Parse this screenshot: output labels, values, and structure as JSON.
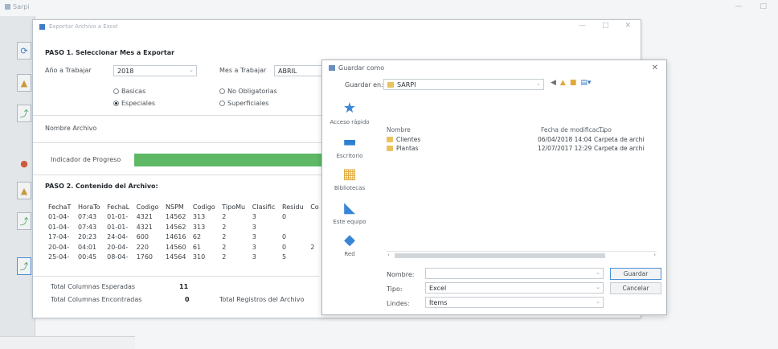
{
  "outer": {
    "title": "Sarpi"
  },
  "main": {
    "title": "Exportar Archivo a Excel",
    "step1": "PASO 1. Seleccionar Mes a Exportar",
    "anio_label": "Año a Trabajar",
    "anio_value": "2018",
    "mes_label": "Mes a Trabajar",
    "mes_value": "ABRIL",
    "radios": [
      {
        "label": "Basicas",
        "checked": false
      },
      {
        "label": "Especiales",
        "checked": true
      },
      {
        "label": "No Obligatorias",
        "checked": false
      },
      {
        "label": "Superficiales",
        "checked": false
      }
    ],
    "nombre_label": "Nombre Archivo",
    "progress_label": "Indicador de Progreso",
    "progress_fraction": 1.0,
    "step2": "PASO 2. Contenido del Archivo:",
    "table": {
      "headers": [
        "FechaT",
        "HoraTo",
        "FechaL",
        "Codigo",
        "NSPM",
        "Codigo",
        "TipoMu",
        "Clasific",
        "Residu",
        "Co"
      ],
      "rows": [
        [
          "01-04-",
          "07:43",
          "01-01-",
          "4321",
          "14562",
          "313",
          "2",
          "3",
          "0",
          ""
        ],
        [
          "01-04-",
          "07:43",
          "01-01-",
          "4321",
          "14562",
          "313",
          "2",
          "3",
          "",
          ""
        ],
        [
          "17-04-",
          "20:23",
          "24-04-",
          "600",
          "14616",
          "62",
          "2",
          "3",
          "0",
          ""
        ],
        [
          "20-04-",
          "04:01",
          "20-04-",
          "220",
          "14560",
          "61",
          "2",
          "3",
          "0",
          "2"
        ],
        [
          "25-04-",
          "00:45",
          "08-04-",
          "1760",
          "14564",
          "310",
          "2",
          "3",
          "5",
          ""
        ]
      ]
    },
    "total_esperadas_label": "Total Columnas Esperadas",
    "total_esperadas_value": "11",
    "total_encontradas_label": "Total Columnas Encontradas",
    "total_encontradas_value": "0",
    "total_registros_label": "Total Registros del Archivo"
  },
  "dialog": {
    "title": "Guardar como",
    "guardar_en_label": "Guardar en:",
    "guardar_en_value": "SARPI",
    "toolbar_icons": [
      "back-icon",
      "up-folder-icon",
      "new-folder-icon",
      "view-menu-icon"
    ],
    "places": [
      "Acceso rápido",
      "Escritorio",
      "Bibliotecas",
      "Este equipo",
      "Red"
    ],
    "columns": [
      "Nombre",
      "Fecha de modificac...",
      "Tipo"
    ],
    "files": [
      {
        "name": "Clientes",
        "date": "06/04/2018 14:04",
        "type": "Carpeta de archi"
      },
      {
        "name": "Plantas",
        "date": "12/07/2017 12:29",
        "type": "Carpeta de archi"
      }
    ],
    "nombre_label": "Nombre:",
    "nombre_value": "",
    "tipo_label": "Tipo:",
    "tipo_value": "Excel",
    "lindes_label": "Lindes:",
    "lindes_value": "Ítems",
    "save_button": "Guardar",
    "cancel_button": "Cancelar"
  }
}
